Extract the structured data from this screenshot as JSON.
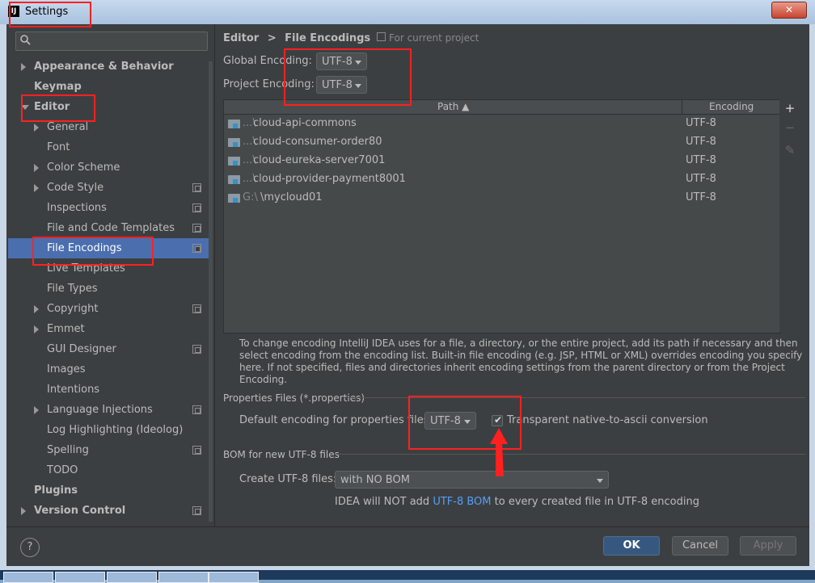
{
  "window": {
    "title": "Settings",
    "logo": "IJ"
  },
  "search": {
    "placeholder": "",
    "icon": "search-icon"
  },
  "sidebar": {
    "items": [
      {
        "label": "Appearance & Behavior",
        "bold": true,
        "arrow": "right"
      },
      {
        "label": "Keymap",
        "bold": true,
        "arrow": ""
      },
      {
        "label": "Editor",
        "bold": true,
        "arrow": "down"
      },
      {
        "label": "General",
        "arrow": "right"
      },
      {
        "label": "Font",
        "arrow": ""
      },
      {
        "label": "Color Scheme",
        "arrow": "right"
      },
      {
        "label": "Code Style",
        "arrow": "right",
        "copy": true
      },
      {
        "label": "Inspections",
        "arrow": "",
        "copy": true
      },
      {
        "label": "File and Code Templates",
        "arrow": "",
        "copy": true
      },
      {
        "label": "File Encodings",
        "arrow": "",
        "copy": true,
        "selected": true
      },
      {
        "label": "Live Templates",
        "arrow": ""
      },
      {
        "label": "File Types",
        "arrow": ""
      },
      {
        "label": "Copyright",
        "arrow": "right",
        "copy": true
      },
      {
        "label": "Emmet",
        "arrow": "right"
      },
      {
        "label": "GUI Designer",
        "arrow": "",
        "copy": true
      },
      {
        "label": "Images",
        "arrow": ""
      },
      {
        "label": "Intentions",
        "arrow": ""
      },
      {
        "label": "Language Injections",
        "arrow": "right",
        "copy": true
      },
      {
        "label": "Log Highlighting (Ideolog)",
        "arrow": ""
      },
      {
        "label": "Spelling",
        "arrow": "",
        "copy": true
      },
      {
        "label": "TODO",
        "arrow": ""
      },
      {
        "label": "Plugins",
        "bold": true,
        "arrow": ""
      },
      {
        "label": "Version Control",
        "bold": true,
        "arrow": "right",
        "copy": true
      }
    ]
  },
  "main": {
    "breadcrumb_parent": "Editor",
    "breadcrumb_sep": ">",
    "breadcrumb_current": "File Encodings",
    "scope_note": "For current project",
    "global_encoding_label": "Global Encoding:",
    "global_encoding_value": "UTF-8",
    "project_encoding_label": "Project Encoding:",
    "project_encoding_value": "UTF-8",
    "table": {
      "col_path": "Path ▲",
      "col_encoding": "Encoding",
      "rows": [
        {
          "prefix": "...\\",
          "name": "cloud-api-commons",
          "encoding": "UTF-8"
        },
        {
          "prefix": "...\\",
          "name": "cloud-consumer-order80",
          "encoding": "UTF-8"
        },
        {
          "prefix": "...\\",
          "name": "cloud-eureka-server7001",
          "encoding": "UTF-8"
        },
        {
          "prefix": "...\\",
          "name": "cloud-provider-payment8001",
          "encoding": "UTF-8"
        },
        {
          "prefix": "G:\\",
          "name": "\\mycloud01",
          "encoding": "UTF-8"
        }
      ]
    },
    "info_text": "To change encoding IntelliJ IDEA uses for a file, a directory, or the entire project, add its path if necessary and then select encoding from the encoding list. Built-in file encoding (e.g. JSP, HTML or XML) overrides encoding you specify here. If not specified, files and directories inherit encoding settings from the parent directory or from the Project Encoding.",
    "properties_section": "Properties Files (*.properties)",
    "properties_label": "Default encoding for properties files:",
    "properties_value": "UTF-8",
    "native_to_ascii_label": "Transparent native-to-ascii conversion",
    "native_to_ascii_checked": true,
    "bom_section": "BOM for new UTF-8 files",
    "create_label": "Create UTF-8 files:",
    "create_value": "with NO BOM",
    "bom_note_prefix": "IDEA will NOT add ",
    "bom_note_link": "UTF-8 BOM",
    "bom_note_suffix": " to every created file in UTF-8 encoding"
  },
  "buttons": {
    "help": "?",
    "ok": "OK",
    "cancel": "Cancel",
    "apply": "Apply"
  },
  "colors": {
    "selection": "#4b6eaf",
    "annotation": "#ff2020",
    "link": "#589df6"
  }
}
